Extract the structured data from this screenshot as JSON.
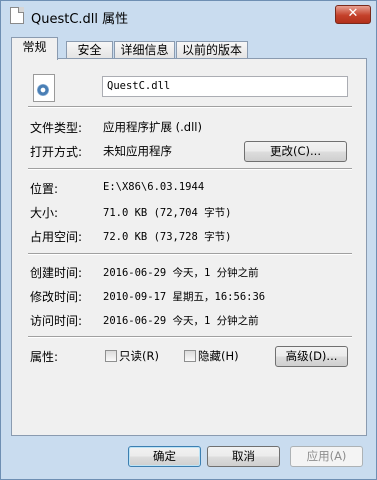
{
  "window": {
    "title": "QuestC.dll 属性",
    "close_glyph": "✕"
  },
  "tabs": [
    {
      "label": "常规",
      "active": true
    },
    {
      "label": "安全",
      "active": false
    },
    {
      "label": "详细信息",
      "active": false
    },
    {
      "label": "以前的版本",
      "active": false
    }
  ],
  "general": {
    "file_name": "QuestC.dll",
    "type_label": "文件类型:",
    "type_value": "应用程序扩展 (.dll)",
    "opens_with_label": "打开方式:",
    "opens_with_value": "未知应用程序",
    "change_button": "更改(C)...",
    "location_label": "位置:",
    "location_value": "E:\\X86\\6.03.1944",
    "size_label": "大小:",
    "size_value": "71.0 KB (72,704 字节)",
    "size_on_disk_label": "占用空间:",
    "size_on_disk_value": "72.0 KB (73,728 字节)",
    "created_label": "创建时间:",
    "created_value": "2016-06-29 今天，1 分钟之前",
    "modified_label": "修改时间:",
    "modified_value": "2010-09-17 星期五，16:56:36",
    "accessed_label": "访问时间:",
    "accessed_value": "2016-06-29 今天，1 分钟之前",
    "attributes_label": "属性:",
    "readonly_label": "只读(R)",
    "readonly_checked": false,
    "hidden_label": "隐藏(H)",
    "hidden_checked": false,
    "advanced_button": "高级(D)..."
  },
  "footer": {
    "ok_button": "确定",
    "cancel_button": "取消",
    "apply_button": "应用(A)"
  }
}
